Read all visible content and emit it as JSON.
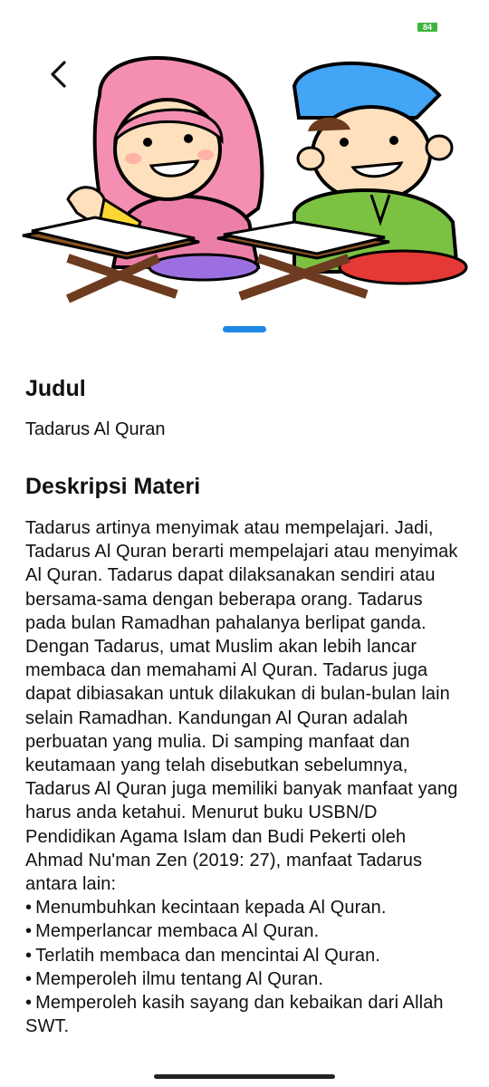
{
  "status": {
    "battery": "84"
  },
  "header": {
    "illustration": "tadarus-children-reading-quran",
    "back_icon": "chevron-left-icon"
  },
  "pager": {
    "active_index": 0,
    "color": "#1e88e5"
  },
  "judul": {
    "heading": "Judul",
    "value": "Tadarus Al Quran"
  },
  "deskripsi": {
    "heading": "Deskripsi Materi",
    "paragraph": "Tadarus artinya menyimak atau mempelajari. Jadi, Tadarus Al Quran berarti mempelajari atau menyimak Al Quran. Tadarus dapat dilaksanakan sendiri atau bersama-sama dengan beberapa orang. Tadarus pada bulan Ramadhan pahalanya berlipat ganda. Dengan Tadarus, umat Muslim akan lebih lancar membaca dan memahami Al Quran. Tadarus juga dapat dibiasakan untuk dilakukan di bulan-bulan lain selain Ramadhan. Kandungan Al Quran adalah perbuatan yang mulia. Di samping manfaat dan keutamaan yang telah disebutkan sebelumnya, Tadarus Al Quran juga memiliki banyak manfaat yang harus anda ketahui. Menurut buku USBN/D Pendidikan Agama Islam dan Budi Pekerti oleh Ahmad Nu'man Zen (2019: 27), manfaat Tadarus antara lain:",
    "bullets": [
      "Menumbuhkan kecintaan kepada Al Quran.",
      "Memperlancar membaca Al Quran.",
      "Terlatih membaca dan mencintai Al Quran.",
      "Memperoleh ilmu tentang Al Quran.",
      "Memperoleh kasih sayang dan kebaikan dari Allah SWT."
    ]
  }
}
